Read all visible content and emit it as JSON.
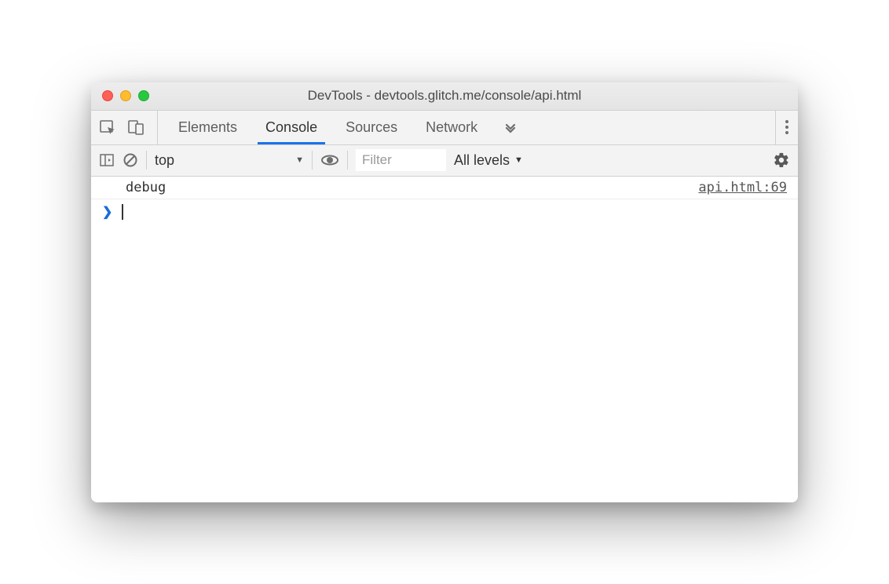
{
  "window": {
    "title": "DevTools - devtools.glitch.me/console/api.html"
  },
  "toolbar": {
    "tabs": [
      {
        "label": "Elements",
        "active": false
      },
      {
        "label": "Console",
        "active": true
      },
      {
        "label": "Sources",
        "active": false
      },
      {
        "label": "Network",
        "active": false
      }
    ]
  },
  "filterbar": {
    "context": "top",
    "filter_placeholder": "Filter",
    "filter_value": "",
    "levels": "All levels"
  },
  "console": {
    "logs": [
      {
        "message": "debug",
        "source": "api.html:69"
      }
    ]
  }
}
